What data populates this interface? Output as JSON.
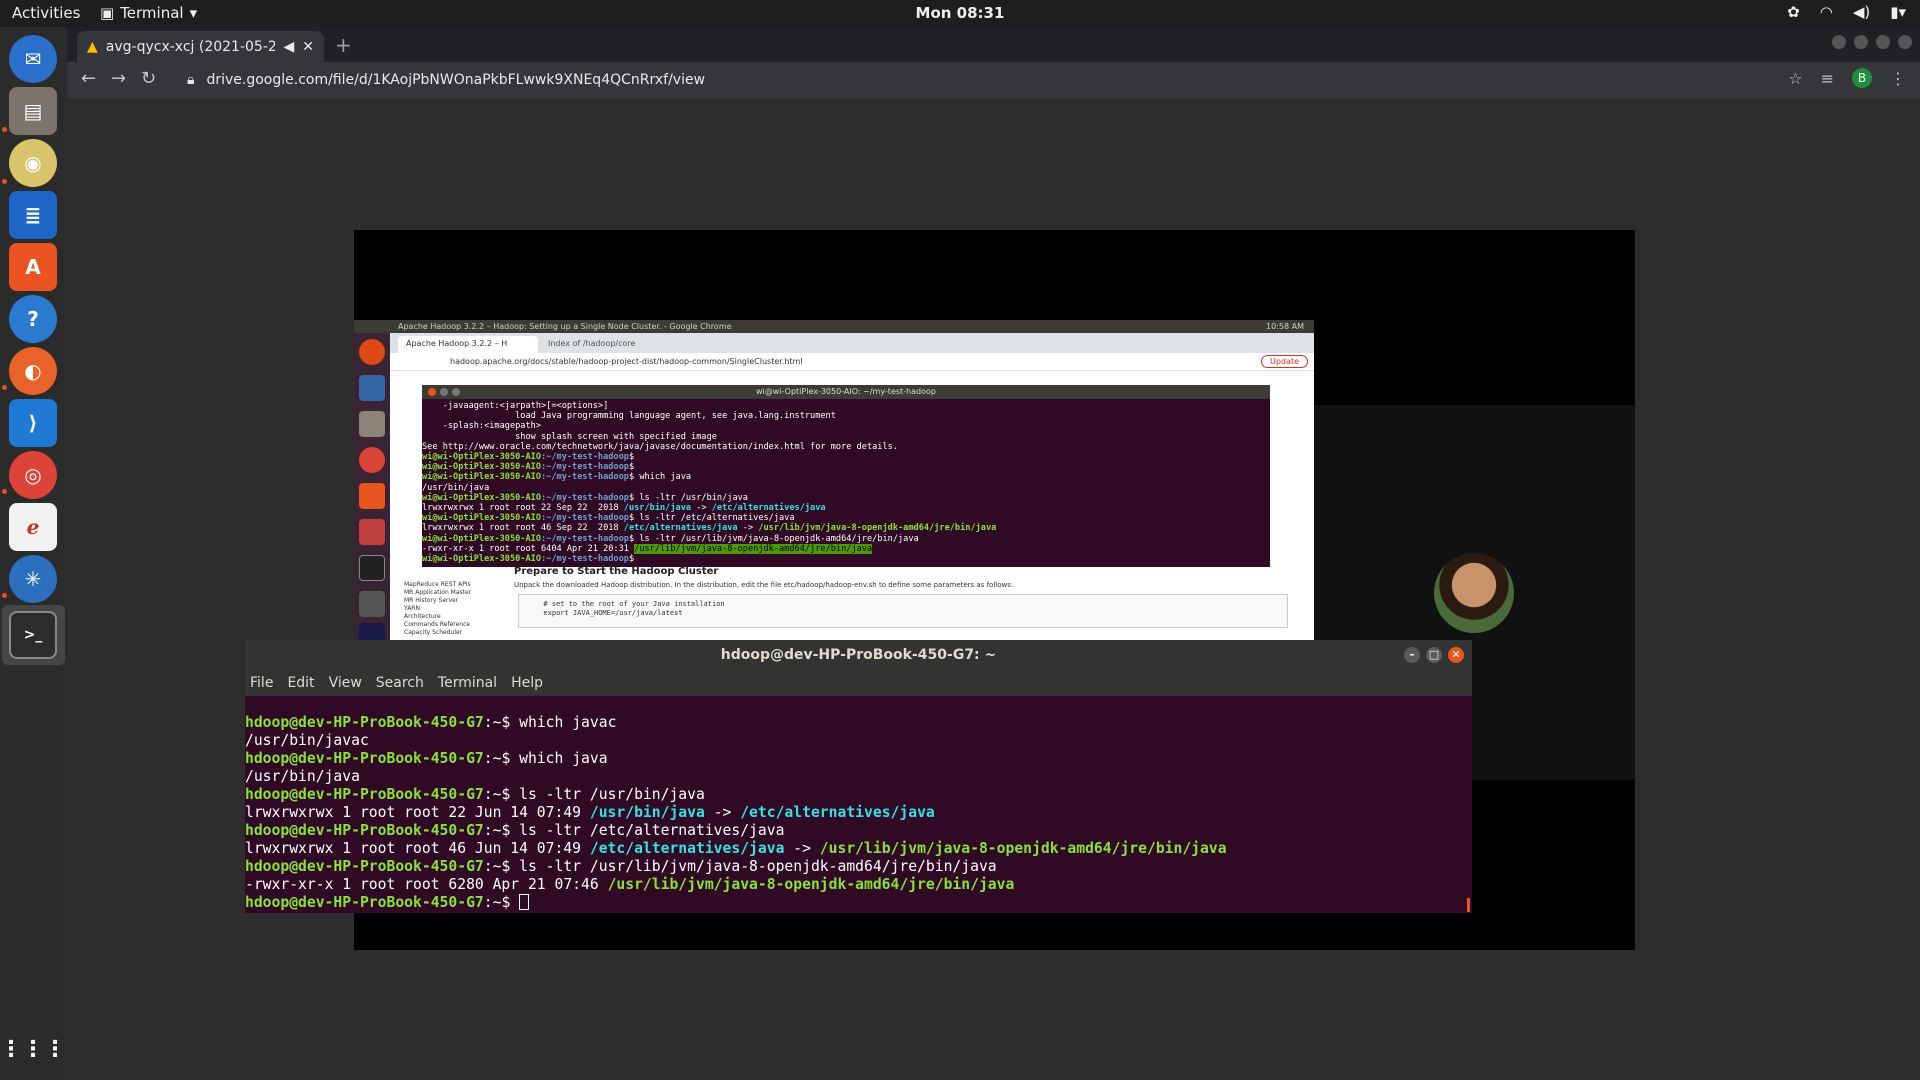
{
  "topbar": {
    "activities": "Activities",
    "app_name": "Terminal",
    "clock": "Mon 08:31"
  },
  "dock": {
    "items": [
      "thunderbird-icon",
      "files-icon",
      "rhythmbox-icon",
      "writer-icon",
      "software-icon",
      "help-icon",
      "firefox-icon",
      "vscode-icon",
      "chrome-icon",
      "screenshot-icon",
      "settings-icon",
      "terminal-icon"
    ]
  },
  "browser": {
    "tab_title": "avg-qycx-xcj (2021-05-2",
    "url": "drive.google.com/file/d/1KAojPbNWOnaPkbFLwwk9XNEq4QCnRrxf/view",
    "profile_initial": "B"
  },
  "recorded": {
    "topbar_title": "Apache Hadoop 3.2.2 – Hadoop: Setting up a Single Node Cluster. - Google Chrome",
    "topbar_time": "10:58 AM",
    "tab1": "Apache Hadoop 3.2.2 – H",
    "tab2": "Index of /hadoop/core",
    "url": "hadoop.apache.org/docs/stable/hadoop-project-dist/hadoop-common/SingleCluster.html",
    "update": "Update",
    "sidebar": [
      "MapReduce REST APIs",
      "MR Application Master",
      "MR History Server",
      "YARN",
      "Architecture",
      "Commands Reference",
      "Capacity Scheduler"
    ],
    "heading": "Prepare to Start the Hadoop Cluster",
    "para": "Unpack the downloaded Hadoop distribution. In the distribution, edit the file etc/hadoop/hadoop-env.sh to define some parameters as follows:",
    "code": "  # set to the root of your Java installation\n  export JAVA_HOME=/usr/java/latest",
    "term_title": "wi@wi-OptiPlex-3050-AIO: ~/my-test-hadoop",
    "term_lines": [
      "    -javaagent:<jarpath>[=<options>]",
      "                  load Java programming language agent, see java.lang.instrument",
      "    -splash:<imagepath>",
      "                  show splash screen with specified image",
      "See http://www.oracle.com/technetwork/java/javase/documentation/index.html for more details."
    ],
    "prompt": "wi@wi-OptiPlex-3050-AIO",
    "path": ":~/my-test-hadoop",
    "cmd_which": "$ which java",
    "out_java": "/usr/bin/java",
    "cmd_ls1": "$ ls -ltr /usr/bin/java",
    "out_ls1a": "lrwxrwxrwx 1 root root 22 Sep 22  2018 ",
    "out_ls1b": "/usr/bin/java",
    "out_ls1c": " -> ",
    "out_ls1d": "/etc/alternatives/java",
    "cmd_ls2": "$ ls -ltr /etc/alternatives/java",
    "out_ls2a": "lrwxrwxrwx 1 root root 46 Sep 22  2018 ",
    "out_ls2b": "/etc/alternatives/java",
    "out_ls2c": " -> ",
    "out_ls2d": "/usr/lib/jvm/java-8-openjdk-amd64/jre/bin/java",
    "cmd_ls3": "$ ls -ltr /usr/lib/jvm/java-8-openjdk-amd64/jre/bin/java",
    "out_ls3a": "-rwxr-xr-x 1 root root 6404 Apr 21 20:31 ",
    "out_ls3b": "/usr/lib/jvm/java-8-openjdk-amd64/jre/bin/java",
    "dollar": "$ ",
    "dollar_only": "$"
  },
  "terminal": {
    "title": "hdoop@dev-HP-ProBook-450-G7: ~",
    "menu": [
      "File",
      "Edit",
      "View",
      "Search",
      "Terminal",
      "Help"
    ],
    "prompt": "hdoop@dev-HP-ProBook-450-G7",
    "path": ":~$ ",
    "lines": {
      "cmd1": "which javac",
      "out1": "/usr/bin/javac",
      "cmd2": "which java",
      "out2": "/usr/bin/java",
      "cmd3": "ls -ltr /usr/bin/java",
      "out3a": "lrwxrwxrwx 1 root root 22 Jun 14 07:49 ",
      "out3b": "/usr/bin/java",
      "out3c": " -> ",
      "out3d": "/etc/alternatives/java",
      "cmd4": "ls -ltr /etc/alternatives/java",
      "out4a": "lrwxrwxrwx 1 root root 46 Jun 14 07:49 ",
      "out4b": "/etc/alternatives/java",
      "out4c": " -> ",
      "out4d": "/usr/lib/jvm/java-8-openjdk-amd64/jre/bin/java",
      "cmd5": "ls -ltr /usr/lib/jvm/java-8-openjdk-amd64/jre/bin/java",
      "out5a": "-rwxr-xr-x 1 root root 6280 Apr 21 07:46 ",
      "out5b": "/usr/lib/jvm/java-8-openjdk-amd64/jre/bin/java"
    }
  },
  "colors": {
    "terminal_bg": "#300a24",
    "prompt_green": "#8ae234",
    "link_cyan": "#34e2e2",
    "ubuntu_orange": "#e95420"
  }
}
